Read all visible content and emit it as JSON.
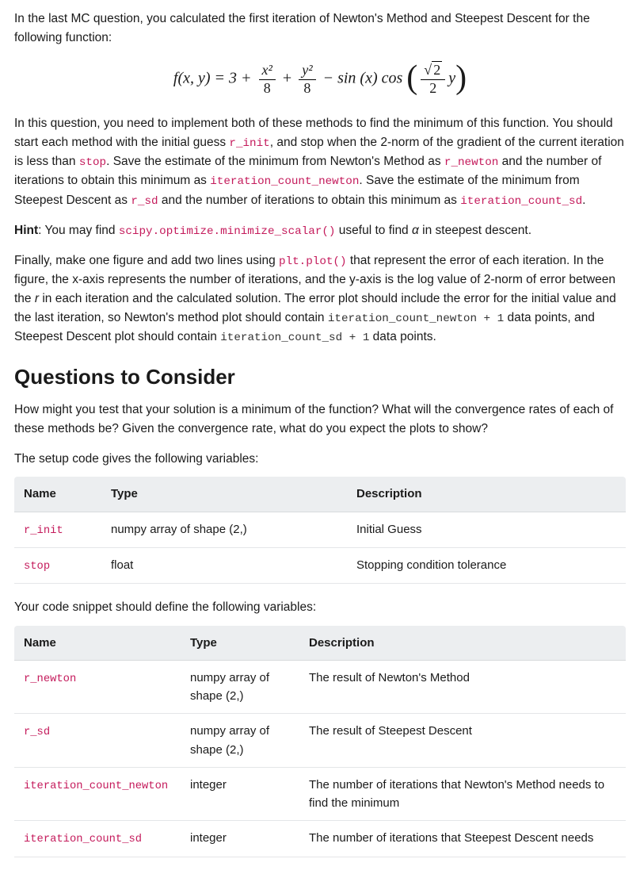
{
  "intro": {
    "p1a": "In the last MC question, you calculated the first iteration of Newton's Method and Steepest Descent for the following function:",
    "p2a": "In this question, you need to implement both of these methods to find the minimum of this function. You should start each method with the initial guess ",
    "p2b": ", and stop when the 2-norm of the gradient of the current iteration is less than ",
    "p2c": ". Save the estimate of the minimum from Newton's Method as ",
    "p2d": " and the number of iterations to obtain this minimum as ",
    "p2e": ". Save the estimate of the minimum from Steepest Descent as ",
    "p2f": " and the number of iterations to obtain this minimum as ",
    "p2g": "."
  },
  "code": {
    "r_init": "r_init",
    "stop": "stop",
    "r_newton": "r_newton",
    "iter_newton": "iteration_count_newton",
    "r_sd": "r_sd",
    "iter_sd": "iteration_count_sd",
    "scipy": "scipy.optimize.minimize_scalar()",
    "plt_plot": "plt.plot()",
    "iter_newton_p1": "iteration_count_newton + 1",
    "iter_sd_p1": "iteration_count_sd + 1"
  },
  "hint": {
    "label": "Hint",
    "a": ": You may find ",
    "b": " useful to find ",
    "alpha": "α",
    "c": " in steepest descent."
  },
  "plotpara": {
    "a": "Finally, make one figure and add two lines using ",
    "b": " that represent the error of each iteration. In the figure, the x-axis represents the number of iterations, and the y-axis is the log value of 2-norm of error between the ",
    "r": "r",
    "c": " in each iteration and the calculated solution. The error plot should include the error for the initial value and the last iteration, so Newton's method plot should contain ",
    "d": " data points, and Steepest Descent plot should contain ",
    "e": " data points."
  },
  "qtc": {
    "heading": "Questions to Consider",
    "body": "How might you test that your solution is a minimum of the function? What will the convergence rates of each of these methods be? Given the convergence rate, what do you expect the plots to show?"
  },
  "tbl1": {
    "intro": "The setup code gives the following variables:",
    "headers": {
      "name": "Name",
      "type": "Type",
      "desc": "Description"
    },
    "rows": [
      {
        "name": "r_init",
        "type": "numpy array of shape (2,)",
        "desc": "Initial Guess"
      },
      {
        "name": "stop",
        "type": "float",
        "desc": "Stopping condition tolerance"
      }
    ]
  },
  "tbl2": {
    "intro": "Your code snippet should define the following variables:",
    "headers": {
      "name": "Name",
      "type": "Type",
      "desc": "Description"
    },
    "rows": [
      {
        "name": "r_newton",
        "type": "numpy array of shape (2,)",
        "desc": "The result of Newton's Method"
      },
      {
        "name": "r_sd",
        "type": "numpy array of shape (2,)",
        "desc": "The result of Steepest Descent"
      },
      {
        "name": "iteration_count_newton",
        "type": "integer",
        "desc": "The number of iterations that Newton's Method needs to find the minimum"
      },
      {
        "name": "iteration_count_sd",
        "type": "integer",
        "desc": "The number of iterations that Steepest Descent needs"
      }
    ]
  },
  "formula": {
    "lhs": "f(x, y) = 3 +",
    "f1num": "x²",
    "f1den": "8",
    "plus": "+",
    "f2num": "y²",
    "f2den": "8",
    "minus": "− sin (x) cos",
    "f3num_sqrt": "2",
    "f3den": "2",
    "f3tail": "y"
  }
}
